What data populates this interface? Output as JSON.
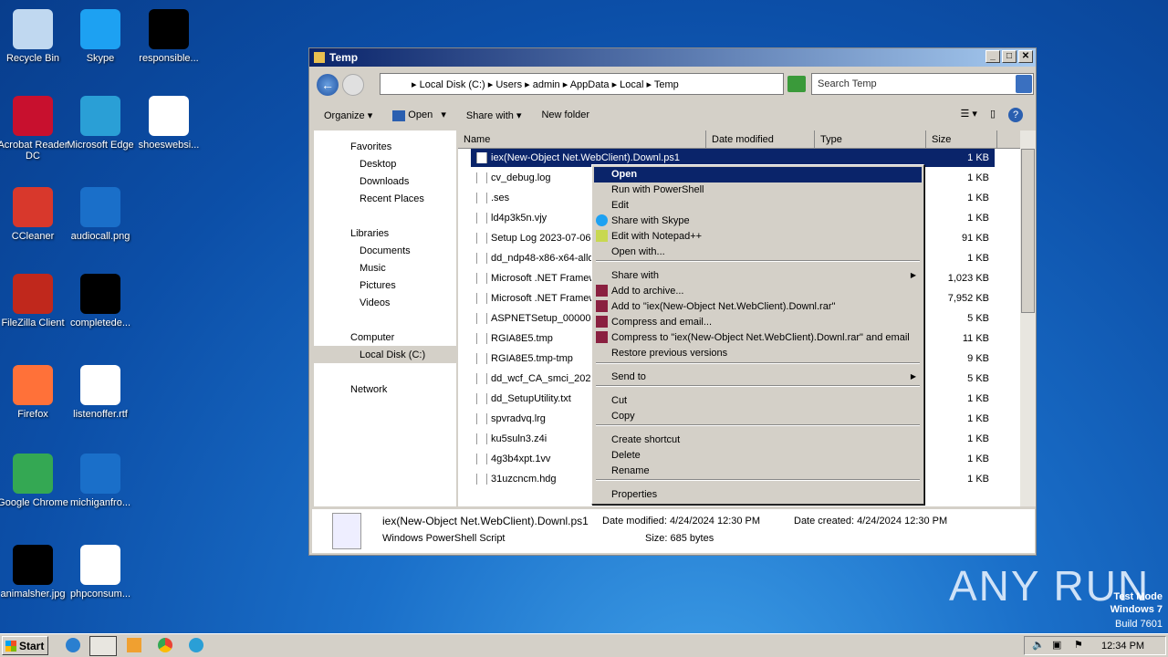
{
  "desktop": {
    "icons": [
      {
        "label": "Recycle Bin",
        "color": "#c0d8f0"
      },
      {
        "label": "Skype",
        "color": "#1da1f2"
      },
      {
        "label": "responsible...",
        "color": "#000000"
      },
      {
        "label": "Acrobat Reader DC",
        "color": "#c8102e"
      },
      {
        "label": "Microsoft Edge",
        "color": "#2a9fd6"
      },
      {
        "label": "shoeswebsi...",
        "color": "#ffffff"
      },
      {
        "label": "CCleaner",
        "color": "#d8382c"
      },
      {
        "label": "audiocall.png",
        "color": "#1a6fc9"
      },
      {
        "label": "FileZilla Client",
        "color": "#c0281c"
      },
      {
        "label": "completede...",
        "color": "#000000"
      },
      {
        "label": "Firefox",
        "color": "#ff7139"
      },
      {
        "label": "listenoffer.rtf",
        "color": "#ffffff"
      },
      {
        "label": "Google Chrome",
        "color": "#34a853"
      },
      {
        "label": "michiganfro...",
        "color": "#1a6fc9"
      },
      {
        "label": "animalsher.jpg",
        "color": "#000000"
      },
      {
        "label": "phpconsum...",
        "color": "#ffffff"
      }
    ]
  },
  "window": {
    "title": "Temp",
    "breadcrumb": [
      "Local Disk (C:)",
      "Users",
      "admin",
      "AppData",
      "Local",
      "Temp"
    ],
    "search_placeholder": "Search Temp",
    "toolbar": {
      "organize": "Organize",
      "open": "Open",
      "share": "Share with",
      "new_folder": "New folder"
    },
    "nav": {
      "favorites": "Favorites",
      "desktop": "Desktop",
      "downloads": "Downloads",
      "recent": "Recent Places",
      "libraries": "Libraries",
      "documents": "Documents",
      "music": "Music",
      "pictures": "Pictures",
      "videos": "Videos",
      "computer": "Computer",
      "local_disk": "Local Disk (C:)",
      "network": "Network"
    },
    "columns": [
      "Name",
      "Date modified",
      "Type",
      "Size"
    ],
    "files": [
      {
        "name": "iex(New-Object Net.WebClient).Downl.ps1",
        "size": "1 KB"
      },
      {
        "name": "cv_debug.log",
        "size": "1 KB"
      },
      {
        "name": ".ses",
        "size": "1 KB"
      },
      {
        "name": "ld4p3k5n.vjy",
        "size": "1 KB"
      },
      {
        "name": "Setup Log 2023-07-06",
        "size": "91 KB"
      },
      {
        "name": "dd_ndp48-x86-x64-allos",
        "size": "1 KB"
      },
      {
        "name": "Microsoft .NET Framework",
        "size": "1,023 KB"
      },
      {
        "name": "Microsoft .NET Framework",
        "size": "7,952 KB"
      },
      {
        "name": "ASPNETSetup_00000.log",
        "size": "5 KB"
      },
      {
        "name": "RGIA8E5.tmp",
        "size": "11 KB"
      },
      {
        "name": "RGIA8E5.tmp-tmp",
        "size": "9 KB"
      },
      {
        "name": "dd_wcf_CA_smci_2023",
        "size": "5 KB"
      },
      {
        "name": "dd_SetupUtility.txt",
        "size": "1 KB"
      },
      {
        "name": "spvradvq.lrg",
        "size": "1 KB"
      },
      {
        "name": "ku5suln3.z4i",
        "size": "1 KB"
      },
      {
        "name": "4g3b4xpt.1vv",
        "size": "1 KB"
      },
      {
        "name": "31uzcncm.hdg",
        "size": "1 KB"
      }
    ],
    "details": {
      "filename": "iex(New-Object Net.WebClient).Downl.ps1",
      "type": "Windows PowerShell Script",
      "modified": "Date modified: 4/24/2024 12:30 PM",
      "created": "Date created: 4/24/2024 12:30 PM",
      "size": "Size: 685 bytes"
    }
  },
  "context_menu": {
    "items": [
      "Open",
      "Run with PowerShell",
      "Edit",
      "Share with Skype",
      "Edit with Notepad++",
      "Open with...",
      "Share with",
      "Add to archive...",
      "Add to \"iex(New-Object Net.WebClient).Downl.rar\"",
      "Compress and email...",
      "Compress to \"iex(New-Object Net.WebClient).Downl.rar\" and email",
      "Restore previous versions",
      "Send to",
      "Cut",
      "Copy",
      "Create shortcut",
      "Delete",
      "Rename",
      "Properties"
    ]
  },
  "taskbar": {
    "start": "Start",
    "clock": "12:34 PM"
  },
  "watermark": {
    "brand": "ANY RUN",
    "line1": "Test Mode",
    "line2": "Windows 7",
    "line3": "Build 7601"
  }
}
